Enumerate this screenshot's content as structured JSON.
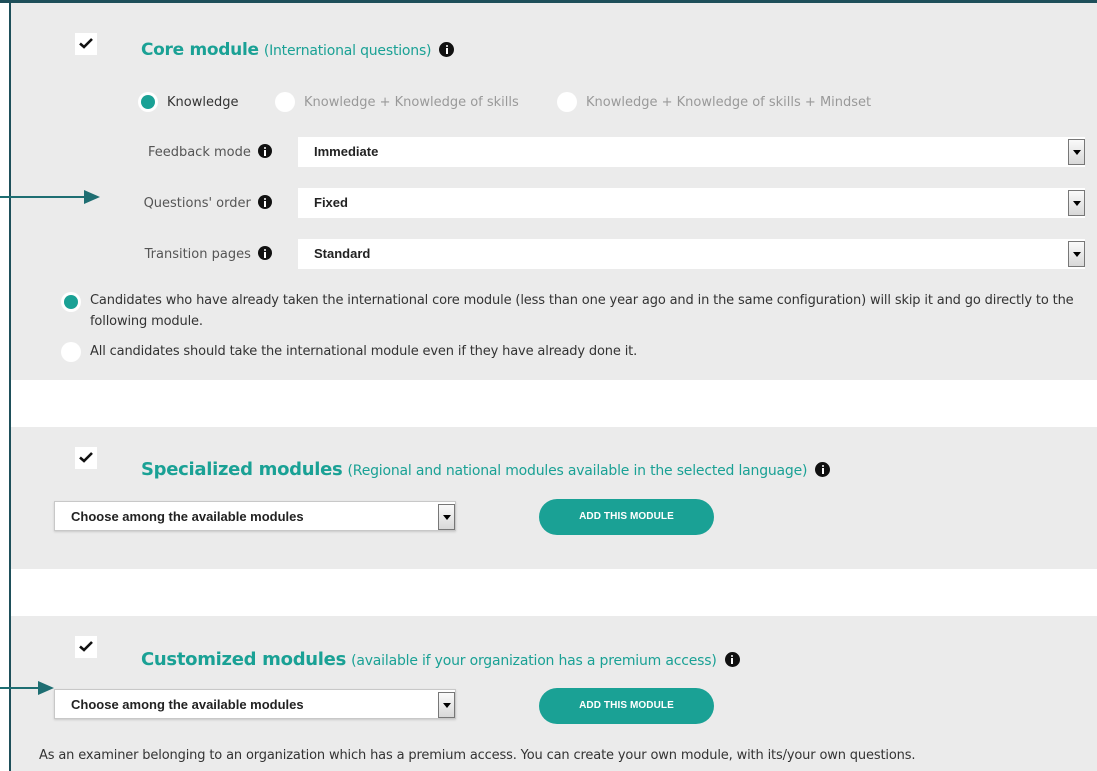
{
  "core": {
    "title": "Core module",
    "subtitle": "(International questions)",
    "info_icon": "info-icon",
    "checked": true,
    "levels": [
      {
        "label": "Knowledge",
        "selected": true
      },
      {
        "label": "Knowledge + Knowledge of skills",
        "selected": false
      },
      {
        "label": "Knowledge + Knowledge of skills + Mindset",
        "selected": false
      }
    ],
    "fields": {
      "feedback": {
        "label": "Feedback mode",
        "value": "Immediate"
      },
      "order": {
        "label": "Questions' order",
        "value": "Fixed"
      },
      "transition": {
        "label": "Transition pages",
        "value": "Standard"
      }
    },
    "skip_options": [
      {
        "text": "Candidates who have already taken the international core module (less than one year ago and in the same configuration) will skip it and go directly to the following module.",
        "selected": true
      },
      {
        "text": "All candidates should take the international module even if they have already done it.",
        "selected": false
      }
    ]
  },
  "specialized": {
    "title": "Specialized modules",
    "subtitle": "(Regional and national modules available in the selected language)",
    "checked": true,
    "select_value": "Choose among the available modules",
    "button_label": "ADD THIS MODULE"
  },
  "customized": {
    "title": "Customized modules",
    "subtitle": "(available if your organization has a premium access)",
    "checked": true,
    "select_value": "Choose among the available modules",
    "button_label": "ADD THIS MODULE",
    "note": "As an examiner belonging to an organization which has a premium access. You can create your own module, with its/your own questions."
  },
  "colors": {
    "accent": "#1aa195",
    "panel": "#ebebeb",
    "frame": "#1e4f5a",
    "annotation_arrow": "#1e6e72"
  }
}
